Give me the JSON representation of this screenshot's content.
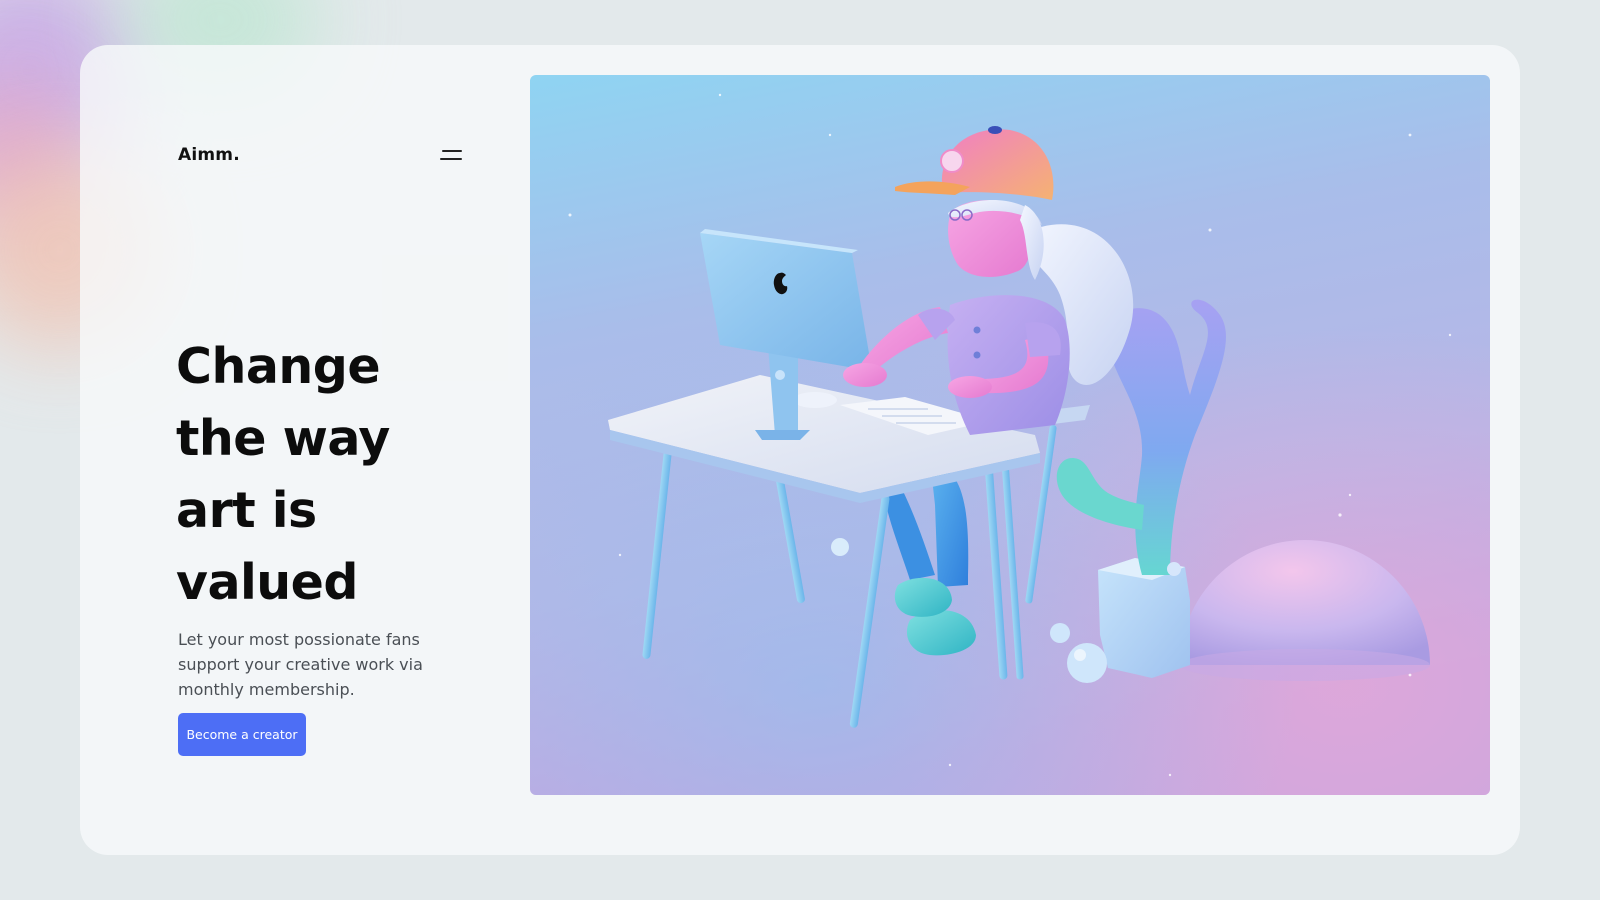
{
  "brand": {
    "name": "Aimm."
  },
  "header": {
    "menu_icon": "hamburger-menu-icon"
  },
  "hero": {
    "headline_lines": [
      "Change",
      "the way",
      "art is",
      "valued"
    ],
    "description": "Let your most possionate fans support your creative work via monthly membership.",
    "cta_label": "Become a creator",
    "image_alt": "3D illustration of a character wearing a cap working at a computer desk next to a cactus"
  },
  "colors": {
    "accent": "#4d6ef5",
    "background": "#e3e9eb",
    "card": "#f7f9fa",
    "text": "#0c0c0c"
  }
}
